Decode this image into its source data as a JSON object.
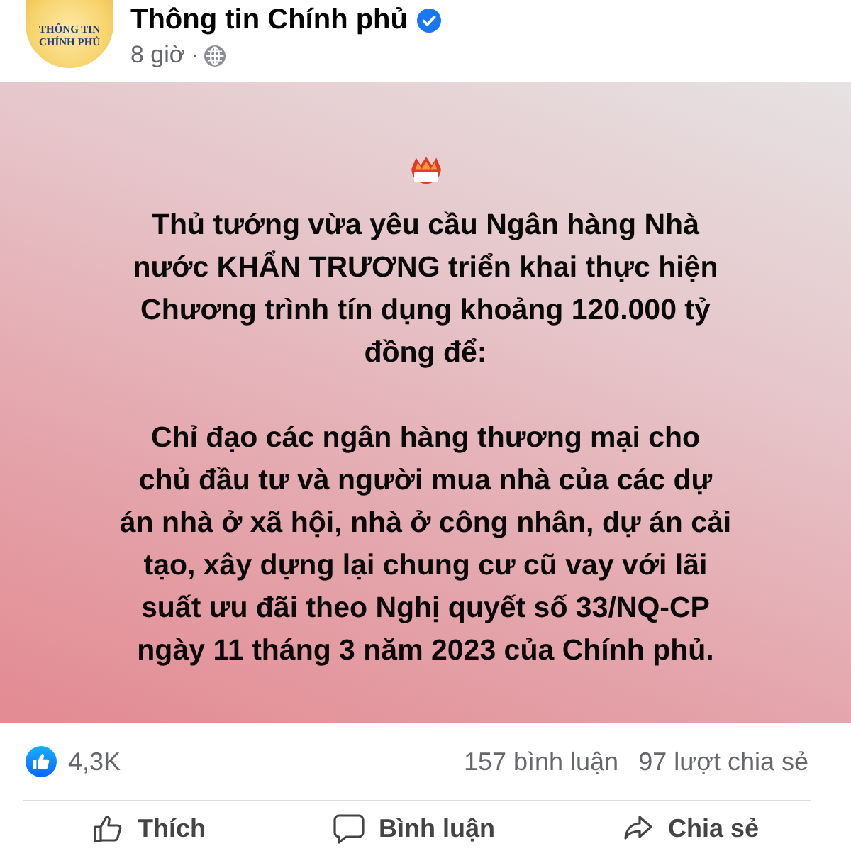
{
  "page": {
    "logo_lines": [
      "THÔNG TIN",
      "CHÍNH PHỦ"
    ],
    "name": "Thông tin Chính phủ",
    "verified": true,
    "time": "8 giờ",
    "separator": "·"
  },
  "post": {
    "paragraphs": [
      "Thủ tướng vừa yêu cầu Ngân hàng Nhà\nnước KHẨN TRƯƠNG triển khai thực hiện\nChương trình tín dụng khoảng 120.000 tỷ\nđồng để:",
      "Chỉ đạo các ngân hàng thương mại cho\nchủ đầu tư và người mua nhà của các dự\nán nhà ở xã hội, nhà ở công nhân, dự án cải\ntạo, xây dựng lại chung cư cũ vay với lãi\nsuất ưu đãi theo Nghị quyết số 33/NQ-CP\nngày 11 tháng 3 năm 2023 của Chính phủ."
    ]
  },
  "stats": {
    "reactions": "4,3K",
    "comments": "157 bình luận",
    "shares": "97 lượt chia sẻ"
  },
  "actions": [
    {
      "kind": "like",
      "label": "Thích"
    },
    {
      "kind": "comment",
      "label": "Bình luận"
    },
    {
      "kind": "share",
      "label": "Chia sẻ"
    }
  ]
}
